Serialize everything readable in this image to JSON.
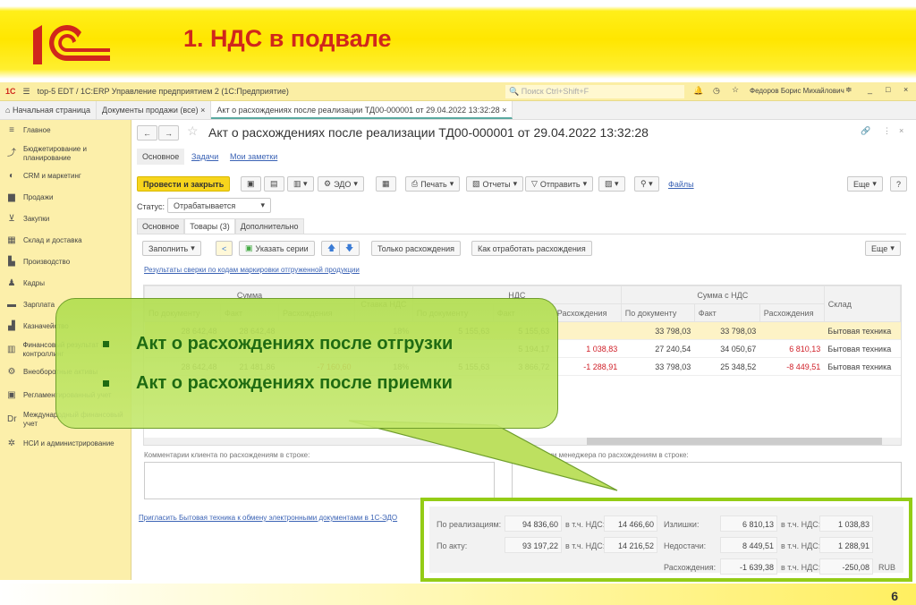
{
  "slide": {
    "title": "1. НДС в подвале",
    "page": "6",
    "logo_text": "1С"
  },
  "colors": {
    "accent": "#d0261c",
    "yellow": "#ffe600",
    "green": "#94cc16",
    "negative": "#d0212a"
  },
  "titlebar": {
    "app": "top-5 EDT / 1С:ERP Управление предприятием 2  (1С:Предприятие)",
    "search_placeholder": "Поиск Ctrl+Shift+F",
    "user": "Федоров Борис Михайлович"
  },
  "tabs": [
    {
      "label": "Начальная страница"
    },
    {
      "label": "Документы продажи (все)"
    },
    {
      "label": "Акт о расхождениях после реализации ТД00-000001 от 29.04.2022 13:32:28"
    }
  ],
  "sidebar": {
    "items": [
      {
        "label": "Главное",
        "icon": "≡"
      },
      {
        "label": "Бюджетирование и планирование",
        "icon": "⤴"
      },
      {
        "label": "CRM и маркетинг",
        "icon": "◐"
      },
      {
        "label": "Продажи",
        "icon": "▆"
      },
      {
        "label": "Закупки",
        "icon": "⊻"
      },
      {
        "label": "Склад и доставка",
        "icon": "▦"
      },
      {
        "label": "Производство",
        "icon": "▙"
      },
      {
        "label": "Кадры",
        "icon": "♟"
      },
      {
        "label": "Зарплата",
        "icon": "▬"
      },
      {
        "label": "Казначейство",
        "icon": "▟"
      },
      {
        "label": "Финансовый результат и контроллинг",
        "icon": "▥"
      },
      {
        "label": "Внеоборотные активы",
        "icon": "⚙"
      },
      {
        "label": "Регламентированный учет",
        "icon": "▣"
      },
      {
        "label": "Международный финансовый учет",
        "icon": "Dr"
      },
      {
        "label": "НСИ и администрирование",
        "icon": "✲"
      }
    ]
  },
  "document": {
    "title": "Акт о расхождениях после реализации ТД00-000001 от 29.04.2022 13:32:28",
    "nav": [
      "Основное",
      "Задачи",
      "Мои заметки"
    ],
    "toolbar": {
      "post_close": "Провести и закрыть",
      "edo": "ЭДО",
      "print": "Печать",
      "reports": "Отчеты",
      "send": "Отправить",
      "files": "Файлы",
      "more": "Еще",
      "help": "?"
    },
    "status_label": "Статус:",
    "status_value": "Отрабатывается",
    "subtabs": [
      "Основное",
      "Товары (3)",
      "Дополнительно"
    ],
    "table_toolbar": {
      "fill": "Заполнить",
      "series": "Указать серии",
      "only_diff": "Только расхождения",
      "how_to": "Как отработать расхождения",
      "more": "Еще"
    },
    "marking_link": "Результаты сверки по кодам маркировки отгруженной продукции",
    "table": {
      "groups": [
        "Сумма",
        "Ставка НДС",
        "НДС",
        "Сумма с НДС",
        "Склад"
      ],
      "subheaders": [
        "По документу",
        "Факт",
        "Расхождения",
        "",
        "По документу",
        "Факт",
        "Расхождения",
        "По документу",
        "Факт",
        "Расхождения",
        ""
      ],
      "rows": [
        [
          "28 642,48",
          "28 642,48",
          "",
          "18%",
          "5 155,63",
          "5 155,63",
          "",
          "33 798,03",
          "33 798,03",
          "",
          "Бытовая техника"
        ],
        [
          "",
          "",
          "",
          "",
          "",
          "5 194,17",
          "1 038,83",
          "27 240,54",
          "34 050,67",
          "6 810,13",
          "Бытовая техника"
        ],
        [
          "28 642,48",
          "21 481,86",
          "-7 160,60",
          "18%",
          "5 155,63",
          "3 866,72",
          "-1 288,91",
          "33 798,03",
          "25 348,52",
          "-8 449,51",
          "Бытовая техника"
        ]
      ]
    },
    "client_comment_label": "Комментарии клиента по расхождениям в строке:",
    "manager_comment_label": "Комментарии менеджера по расхождениям в строке:",
    "invite_link": "Пригласить Бытовая техника  к обмену электронными документами в 1С-ЭДО"
  },
  "callout": {
    "items": [
      "Акт о расхождениях после отгрузки",
      "Акт о расхождениях после приемки"
    ]
  },
  "footer": {
    "by_sales_label": "По реализациям:",
    "by_sales": "94 836,60",
    "vat_label": "в т.ч. НДС:",
    "by_sales_vat": "14 466,60",
    "by_act_label": "По акту:",
    "by_act": "93 197,22",
    "by_act_vat": "14 216,52",
    "surplus_label": "Излишки:",
    "surplus": "6 810,13",
    "surplus_vat": "1 038,83",
    "shortage_label": "Недостачи:",
    "shortage": "8 449,51",
    "shortage_vat": "1 288,91",
    "diff_label": "Расхождения:",
    "diff": "-1 639,38",
    "diff_vat": "-250,08",
    "currency": "RUB"
  }
}
